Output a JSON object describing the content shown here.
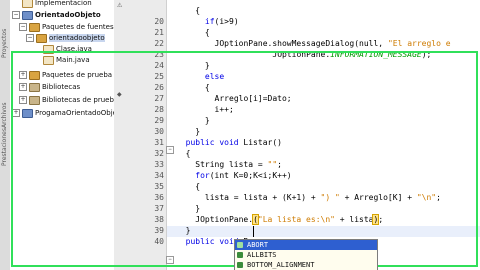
{
  "project_tree": {
    "items": [
      {
        "label": "Implementacion",
        "depth": 0,
        "icon": "java-file-icon",
        "expander": ""
      },
      {
        "label": "OrientadoObjeto",
        "depth": 0,
        "icon": "project-icon",
        "expander": "−",
        "bold": true
      },
      {
        "label": "Paquetes de fuentes",
        "depth": 1,
        "icon": "package-icon",
        "expander": "−"
      },
      {
        "label": "orientadoobjeto",
        "depth": 2,
        "icon": "package-icon",
        "expander": "−",
        "selected": true
      },
      {
        "label": "Clase.java",
        "depth": 3,
        "icon": "java-file-icon",
        "expander": ""
      },
      {
        "label": "Main.java",
        "depth": 3,
        "icon": "java-file-icon",
        "expander": ""
      },
      {
        "label": "Paquetes de prueba",
        "depth": 1,
        "icon": "package-icon",
        "expander": "+"
      },
      {
        "label": "Bibliotecas",
        "depth": 1,
        "icon": "library-icon",
        "expander": "+"
      },
      {
        "label": "Bibliotecas de pruebas",
        "depth": 1,
        "icon": "library-icon",
        "expander": "+"
      },
      {
        "label": "ProgamaOrientadoObjeto",
        "depth": 0,
        "icon": "project-icon",
        "expander": "+"
      }
    ],
    "side_tabs": [
      "Proyectos",
      "Archivos",
      "Prestaciones"
    ]
  },
  "editor": {
    "line_numbers": [
      "",
      "",
      "",
      "",
      "20",
      "21",
      "22",
      "23",
      "24",
      "25",
      "26",
      "27",
      "28",
      "29",
      "30",
      "31",
      "32",
      "33",
      "34",
      "35",
      "36",
      "37",
      "38",
      "39",
      "40"
    ],
    "lines": [
      {
        "indent": 4,
        "tokens": [
          {
            "t": "{",
            "c": "plain"
          }
        ]
      },
      {
        "indent": 6,
        "tokens": [
          {
            "t": "if",
            "c": "kw"
          },
          {
            "t": "(i>9)",
            "c": "plain"
          }
        ]
      },
      {
        "indent": 6,
        "tokens": [
          {
            "t": "{",
            "c": "plain"
          }
        ]
      },
      {
        "indent": 8,
        "tokens": [
          {
            "t": "JOptionPane.showMessageDialog(null, ",
            "c": "plain"
          },
          {
            "t": "\"El arreglo e",
            "c": "st"
          }
        ]
      },
      {
        "indent": 20,
        "tokens": [
          {
            "t": "JOptionPane.",
            "c": "plain"
          },
          {
            "t": "INFORMATION_MESSAGE",
            "c": "fi"
          },
          {
            "t": ");",
            "c": "plain"
          }
        ]
      },
      {
        "indent": 6,
        "tokens": [
          {
            "t": "}",
            "c": "plain"
          }
        ]
      },
      {
        "indent": 6,
        "tokens": [
          {
            "t": "else",
            "c": "kw"
          }
        ]
      },
      {
        "indent": 6,
        "tokens": [
          {
            "t": "{",
            "c": "plain"
          }
        ]
      },
      {
        "indent": 8,
        "tokens": [
          {
            "t": "Arreglo[i]=Dato;",
            "c": "plain"
          }
        ]
      },
      {
        "indent": 8,
        "tokens": [
          {
            "t": "i++;",
            "c": "plain"
          }
        ]
      },
      {
        "indent": 6,
        "tokens": [
          {
            "t": "}",
            "c": "plain"
          }
        ]
      },
      {
        "indent": 4,
        "tokens": [
          {
            "t": "}",
            "c": "plain"
          }
        ]
      },
      {
        "indent": 2,
        "tokens": [
          {
            "t": "public void ",
            "c": "kw"
          },
          {
            "t": "Listar()",
            "c": "plain"
          }
        ]
      },
      {
        "indent": 2,
        "tokens": [
          {
            "t": "{",
            "c": "plain"
          }
        ]
      },
      {
        "indent": 4,
        "tokens": [
          {
            "t": "String lista = ",
            "c": "plain"
          },
          {
            "t": "\"\"",
            "c": "st"
          },
          {
            "t": ";",
            "c": "plain"
          }
        ]
      },
      {
        "indent": 4,
        "tokens": [
          {
            "t": "for",
            "c": "kw"
          },
          {
            "t": "(int K=0;K<i;K++)",
            "c": "plain"
          }
        ]
      },
      {
        "indent": 4,
        "tokens": [
          {
            "t": "{",
            "c": "plain"
          }
        ]
      },
      {
        "indent": 6,
        "tokens": [
          {
            "t": "lista = lista + (K+1) + ",
            "c": "plain"
          },
          {
            "t": "\") \"",
            "c": "st"
          },
          {
            "t": " + Arreglo[K] + ",
            "c": "plain"
          },
          {
            "t": "\"\\n\"",
            "c": "st"
          },
          {
            "t": ";",
            "c": "plain"
          }
        ]
      },
      {
        "indent": 4,
        "tokens": [
          {
            "t": "}",
            "c": "plain"
          }
        ]
      },
      {
        "indent": 4,
        "tokens": [
          {
            "t": "JOptionPane.",
            "c": "plain"
          },
          {
            "t": "(",
            "c": "cur"
          },
          {
            "t": "\"La lista es:\\n\"",
            "c": "st"
          },
          {
            "t": " + lista",
            "c": "plain"
          },
          {
            "t": ")",
            "c": "cur"
          },
          {
            "t": ";",
            "c": "plain"
          }
        ]
      },
      {
        "indent": 2,
        "tokens": [
          {
            "t": "}",
            "c": "plain"
          }
        ]
      },
      {
        "indent": 2,
        "tokens": [
          {
            "t": "public void ",
            "c": "kw"
          },
          {
            "t": "B",
            "c": "plain"
          }
        ]
      }
    ]
  },
  "completion_popup": {
    "items": [
      {
        "label": "ABORT",
        "selected": true
      },
      {
        "label": "ALLBITS",
        "selected": false
      },
      {
        "label": "BOTTOM_ALIGNMENT",
        "selected": false
      }
    ]
  },
  "colors": {
    "keyword": "#0000e6",
    "string": "#ce7b00",
    "static_field": "#009900",
    "focus_outline": "#30e05a",
    "popup_selection": "#2e5fd0"
  }
}
